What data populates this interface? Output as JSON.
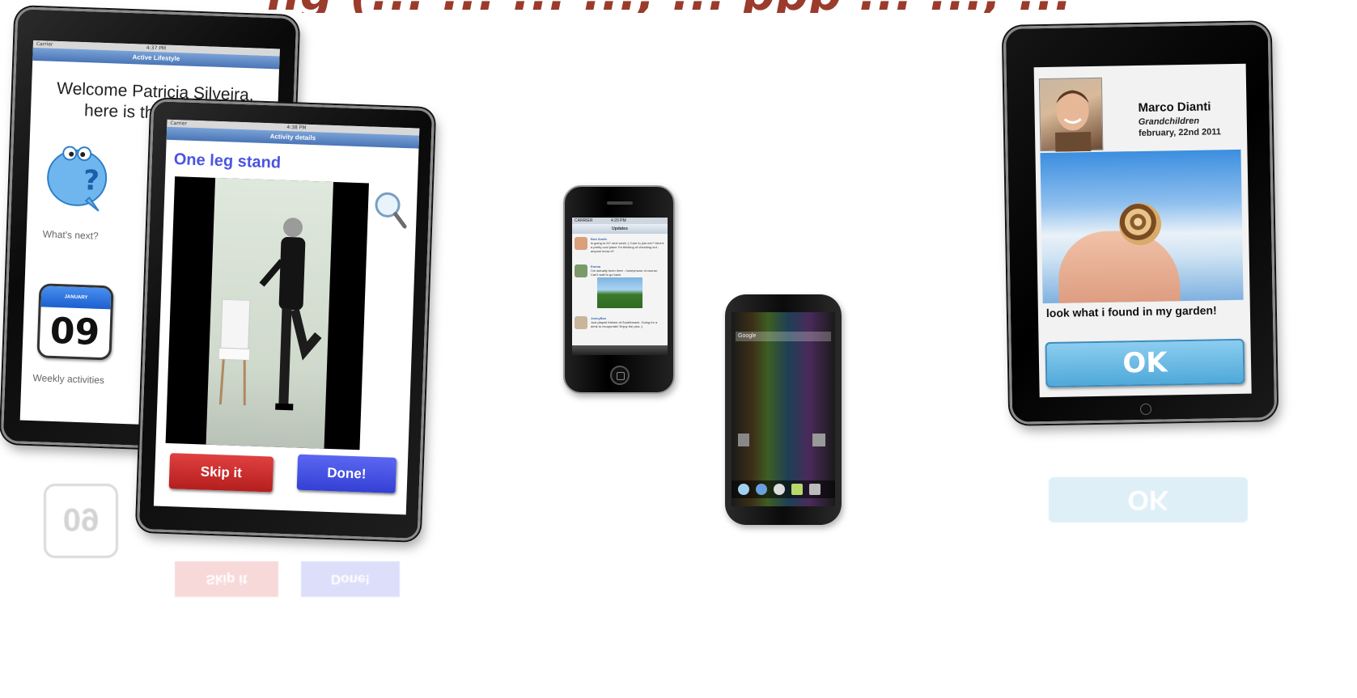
{
  "header": {
    "title_fragment": "ng (... ... ... ..., ... ppp ... ..., ... y ..."
  },
  "tablet_active_lifestyle": {
    "nav_title": "Active Lifestyle",
    "status_carrier": "Carrier",
    "status_time": "4:37 PM",
    "welcome_text": "Welcome Patricia Silveira, here is the list of w",
    "whats_next_label": "What's next?",
    "calendar_month": "JANUARY",
    "calendar_day": "09",
    "weekly_label": "Weekly activities"
  },
  "tablet_activity_details": {
    "nav_title": "Activity details",
    "status_carrier": "Carrier",
    "status_time": "4:38 PM",
    "activity_title": "One leg stand",
    "skip_label": "Skip it",
    "done_label": "Done!"
  },
  "iphone": {
    "status_carrier": "CARRIER",
    "status_time": "4:20 PM",
    "nav_title": "Updates",
    "posts": [
      {
        "name": "Bob Smith",
        "text": "is going to NY next week :) Care to join me? Here's a pretty cool place I'm thinking of checking out - anyone know it?"
      },
      {
        "name": "Emma",
        "text": "I've actually been here - honeymoon of course. Can't wait to go back."
      },
      {
        "name": "JohnyBox",
        "text": "Just played frisbee at Southbeach. Going for a drink to recuperate! Enjoy the pics :)"
      }
    ]
  },
  "android": {
    "search_label": "Google"
  },
  "tablet_message": {
    "sender_name": "Marco Dianti",
    "relation": "Grandchildren",
    "date": "february, 22nd 2011",
    "message": "look what i found in my garden!",
    "ok_label": "OK"
  }
}
